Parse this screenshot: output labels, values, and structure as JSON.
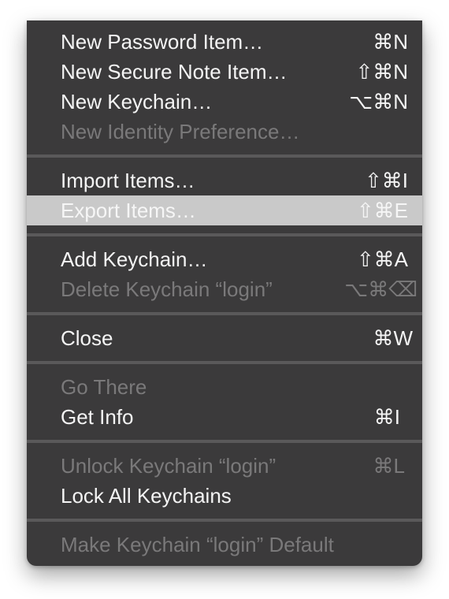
{
  "menu": {
    "items": [
      {
        "label": "New Password Item…",
        "shortcut": "⌘N"
      },
      {
        "label": "New Secure Note Item…",
        "shortcut": "⇧⌘N"
      },
      {
        "label": "New Keychain…",
        "shortcut": "⌥⌘N"
      },
      {
        "label": "New Identity Preference…",
        "shortcut": ""
      },
      {
        "label": "Import Items…",
        "shortcut": "⇧⌘I"
      },
      {
        "label": "Export Items…",
        "shortcut": "⇧⌘E"
      },
      {
        "label": "Add Keychain…",
        "shortcut": "⇧⌘A"
      },
      {
        "label": "Delete Keychain “login”",
        "shortcut": "⌥⌘⌫"
      },
      {
        "label": "Close",
        "shortcut": "⌘W"
      },
      {
        "label": "Go There",
        "shortcut": ""
      },
      {
        "label": "Get Info",
        "shortcut": "⌘I"
      },
      {
        "label": "Unlock Keychain “login”",
        "shortcut": "⌘L"
      },
      {
        "label": "Lock All Keychains",
        "shortcut": ""
      },
      {
        "label": "Make Keychain “login” Default",
        "shortcut": ""
      }
    ]
  },
  "colors": {
    "menu_background": "#3b3a3b",
    "enabled_text": "#f4f4f4",
    "disabled_text": "#7a797a",
    "highlight_background": "#c9c9c9",
    "separator": "#5a595a"
  }
}
